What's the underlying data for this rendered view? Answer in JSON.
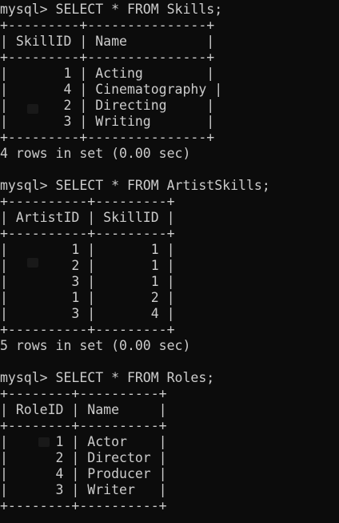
{
  "terminal": {
    "lines": [
      "mysql> SELECT * FROM Skills;",
      "+---------+---------------+",
      "| SkillID | Name          |",
      "+---------+---------------+",
      "|       1 | Acting        |",
      "|       4 | Cinematography |",
      "|       2 | Directing     |",
      "|       3 | Writing       |",
      "+---------+---------------+",
      "4 rows in set (0.00 sec)",
      "",
      "mysql> SELECT * FROM ArtistSkills;",
      "+----------+---------+",
      "| ArtistID | SkillID |",
      "+----------+---------+",
      "|        1 |       1 |",
      "|        2 |       1 |",
      "|        3 |       1 |",
      "|        1 |       2 |",
      "|        3 |       4 |",
      "+----------+---------+",
      "5 rows in set (0.00 sec)",
      "",
      "mysql> SELECT * FROM Roles;",
      "+--------+----------+",
      "| RoleID | Name     |",
      "+--------+----------+",
      "|      1 | Actor    |",
      "|      2 | Director |",
      "|      4 | Producer |",
      "|      3 | Writer   |",
      "+--------+----------+"
    ]
  },
  "colors": {
    "background": "#0c0c0c",
    "text": "#cccccc"
  }
}
